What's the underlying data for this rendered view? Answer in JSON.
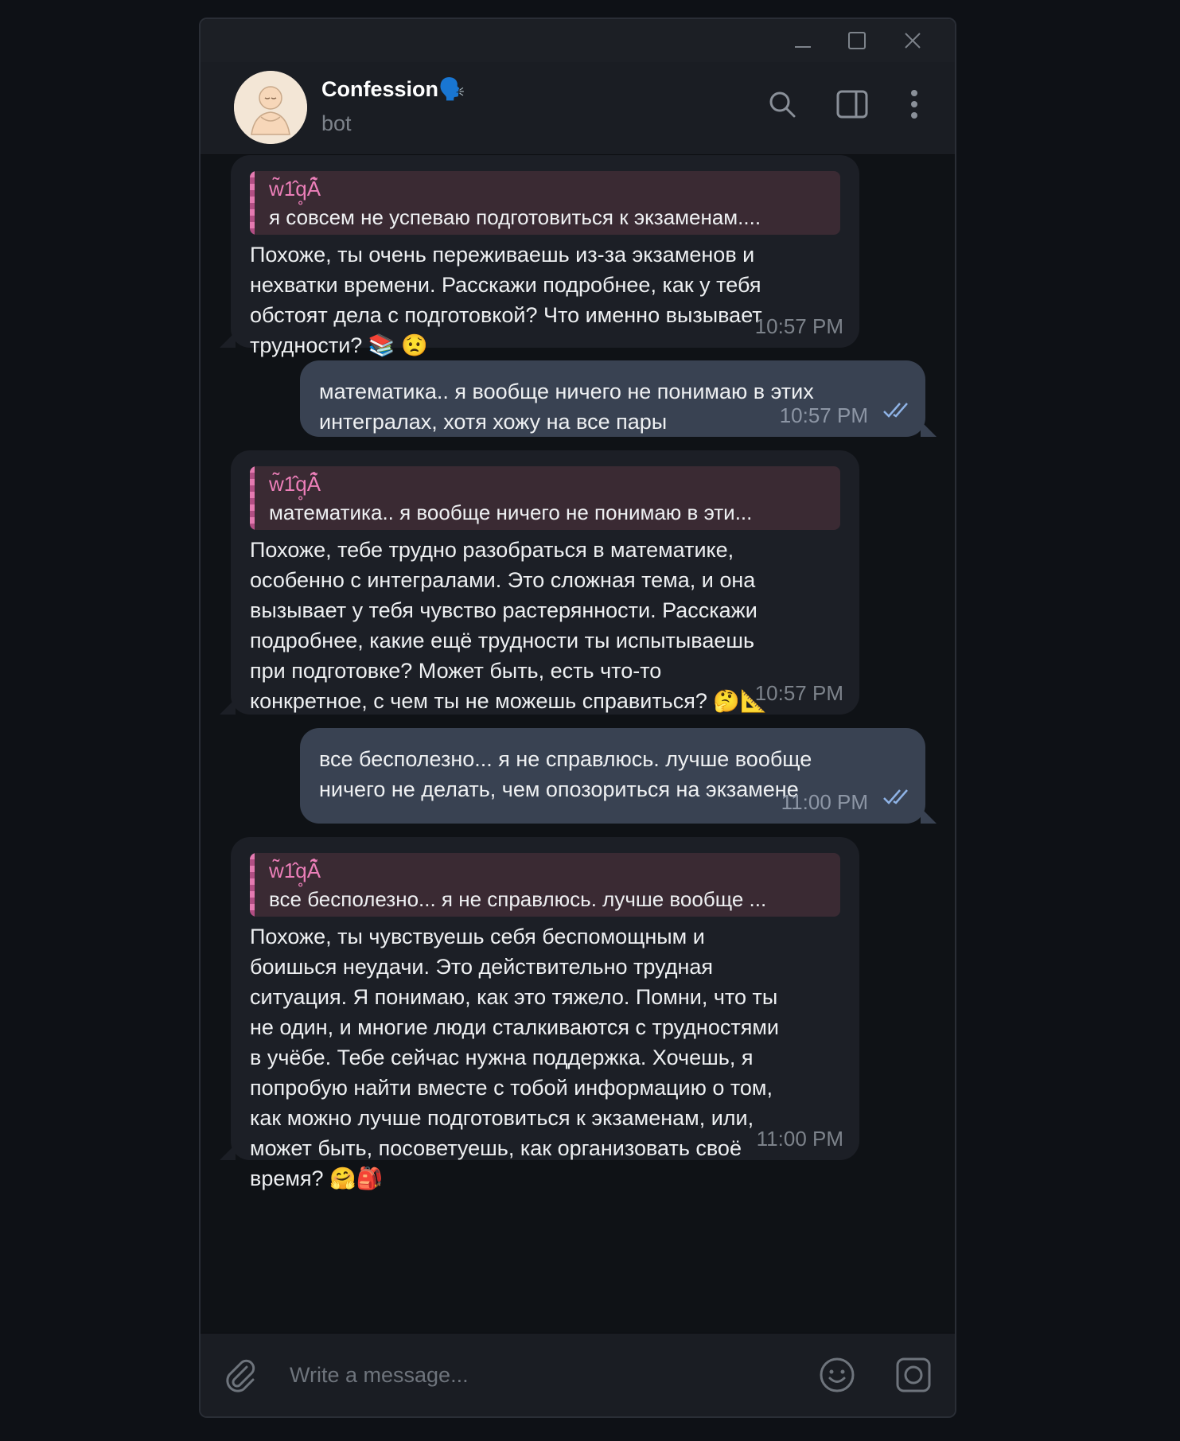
{
  "window": {
    "controls": [
      "minimize-icon",
      "maximize-icon",
      "close-icon"
    ]
  },
  "header": {
    "title": "Confession🗣️",
    "subtitle": "bot",
    "icons": [
      "search-icon",
      "sidebar-toggle-icon",
      "more-vertical-icon"
    ]
  },
  "messages": [
    {
      "type": "incoming",
      "reply_name": "w̃1̂q̥Ã̂",
      "reply_text": "я совсем не успеваю подготовиться к экзаменам....",
      "text": "Похоже, ты очень переживаешь из-за экзаменов и\nнехватки времени. Расскажи подробнее, как у тебя\nобстоят дела с подготовкой? Что именно вызывает\nтрудности? 📚 😟",
      "time": "10:57 PM"
    },
    {
      "type": "outgoing",
      "text": "математика.. я вообще ничего не понимаю в этих\nинтегралах, хотя хожу на все пары",
      "time": "10:57 PM"
    },
    {
      "type": "incoming",
      "reply_name": "w̃1̂q̥Ã̂",
      "reply_text": "математика.. я вообще ничего не понимаю в эти...",
      "text": "Похоже, тебе трудно разобраться в математике,\nособенно с интегралами. Это сложная тема, и она\nвызывает у тебя чувство растерянности. Расскажи\nподробнее, какие ещё трудности ты испытываешь\nпри подготовке? Может быть, есть что-то\nконкретное, с чем ты не можешь справиться? 🤔📐",
      "time": "10:57 PM"
    },
    {
      "type": "outgoing",
      "text": "все бесполезно... я не справлюсь. лучше вообще\nничего не делать, чем опозориться на экзамене",
      "time": "11:00 PM"
    },
    {
      "type": "incoming",
      "reply_name": "w̃1̂q̥Ã̂",
      "reply_text": "все бесполезно... я не справлюсь. лучше вообще ...",
      "text": "Похоже, ты чувствуешь себя беспомощным и\nбоишься неудачи. Это действительно трудная\nситуация. Я понимаю, как это тяжело. Помни, что ты\nне один, и многие люди сталкиваются с трудностями\nв учёбе. Тебе сейчас нужна поддержка. Хочешь, я\nпопробую найти вместе с тобой информацию о том,\nкак можно лучше подготовиться к экзаменам, или,\nможет быть, посоветуешь, как организовать своё\nвремя? 🤗🎒",
      "time": "11:00 PM"
    }
  ],
  "composer": {
    "placeholder": "Write a message...",
    "icons": [
      "attach-icon",
      "emoji-icon",
      "camera-icon"
    ]
  },
  "colors": {
    "background": "#0e1116",
    "incoming_bubble": "#1c1f26",
    "outgoing_bubble": "#394252",
    "reply_name": "#ec7fb9",
    "time": "#7d838b"
  }
}
